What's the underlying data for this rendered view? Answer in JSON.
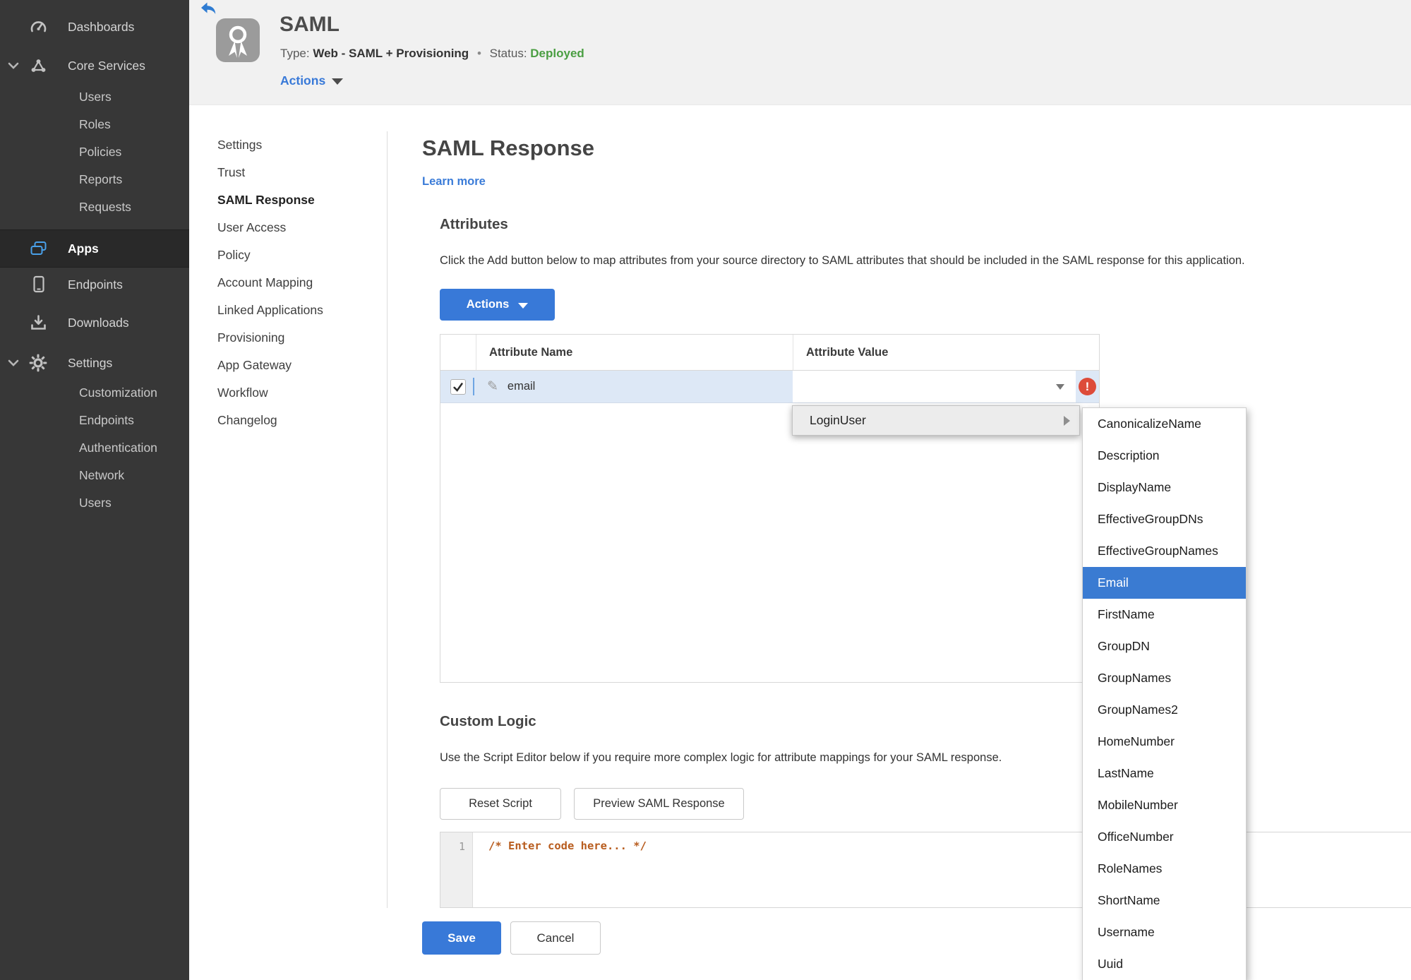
{
  "colors": {
    "accent_blue": "#3879d8",
    "status_green": "#4a9e42",
    "error_red": "#dd4b39",
    "selection_blue": "#3a7bd2",
    "code_comment_orange": "#b85c1e",
    "sidebar_icon_blue": "#49a0e9",
    "row_highlight": "#dde8f6",
    "sidebar_bg": "#373737"
  },
  "sidebar": {
    "dashboards_label": "Dashboards",
    "core_services_label": "Core Services",
    "core_services_children": [
      "Users",
      "Roles",
      "Policies",
      "Reports",
      "Requests"
    ],
    "apps_label": "Apps",
    "endpoints_label": "Endpoints",
    "downloads_label": "Downloads",
    "settings_label": "Settings",
    "settings_children": [
      "Customization",
      "Endpoints",
      "Authentication",
      "Network",
      "Users"
    ]
  },
  "app_header": {
    "title": "SAML",
    "type_label": "Type:",
    "type_value": "Web - SAML + Provisioning",
    "separator": "•",
    "status_label": "Status:",
    "status_value": "Deployed",
    "actions_label": "Actions"
  },
  "nav": {
    "items": [
      {
        "label": "Settings"
      },
      {
        "label": "Trust"
      },
      {
        "label": "SAML Response",
        "active": true
      },
      {
        "label": "User Access"
      },
      {
        "label": "Policy"
      },
      {
        "label": "Account Mapping"
      },
      {
        "label": "Linked Applications"
      },
      {
        "label": "Provisioning"
      },
      {
        "label": "App Gateway"
      },
      {
        "label": "Workflow"
      },
      {
        "label": "Changelog"
      }
    ]
  },
  "main": {
    "title": "SAML Response",
    "learn_more": "Learn more",
    "attributes": {
      "heading": "Attributes",
      "description": "Click the Add button below to map attributes from your source directory to SAML attributes that should be included in the SAML response for this application.",
      "actions_button": "Actions",
      "table": {
        "header": {
          "name_col": "Attribute Name",
          "value_col": "Attribute Value"
        },
        "rows": [
          {
            "name": "email",
            "checked": true,
            "value": ""
          }
        ]
      }
    },
    "value_menu": {
      "items": [
        {
          "label": "LoginUser",
          "has_submenu": true
        }
      ]
    },
    "submenu": {
      "items": [
        {
          "label": "CanonicalizeName"
        },
        {
          "label": "Description"
        },
        {
          "label": "DisplayName"
        },
        {
          "label": "EffectiveGroupDNs"
        },
        {
          "label": "EffectiveGroupNames"
        },
        {
          "label": "Email",
          "selected": true
        },
        {
          "label": "FirstName"
        },
        {
          "label": "GroupDN"
        },
        {
          "label": "GroupNames"
        },
        {
          "label": "GroupNames2"
        },
        {
          "label": "HomeNumber"
        },
        {
          "label": "LastName"
        },
        {
          "label": "MobileNumber"
        },
        {
          "label": "OfficeNumber"
        },
        {
          "label": "RoleNames"
        },
        {
          "label": "ShortName"
        },
        {
          "label": "Username"
        },
        {
          "label": "Uuid"
        }
      ]
    },
    "custom_logic": {
      "heading": "Custom Logic",
      "description": "Use the Script Editor below if you require more complex logic for attribute mappings for your SAML response.",
      "reset_button": "Reset Script",
      "preview_button": "Preview SAML Response",
      "editor": {
        "line_number": "1",
        "code": "/* Enter code here... */"
      }
    },
    "save_button": "Save",
    "cancel_button": "Cancel"
  }
}
